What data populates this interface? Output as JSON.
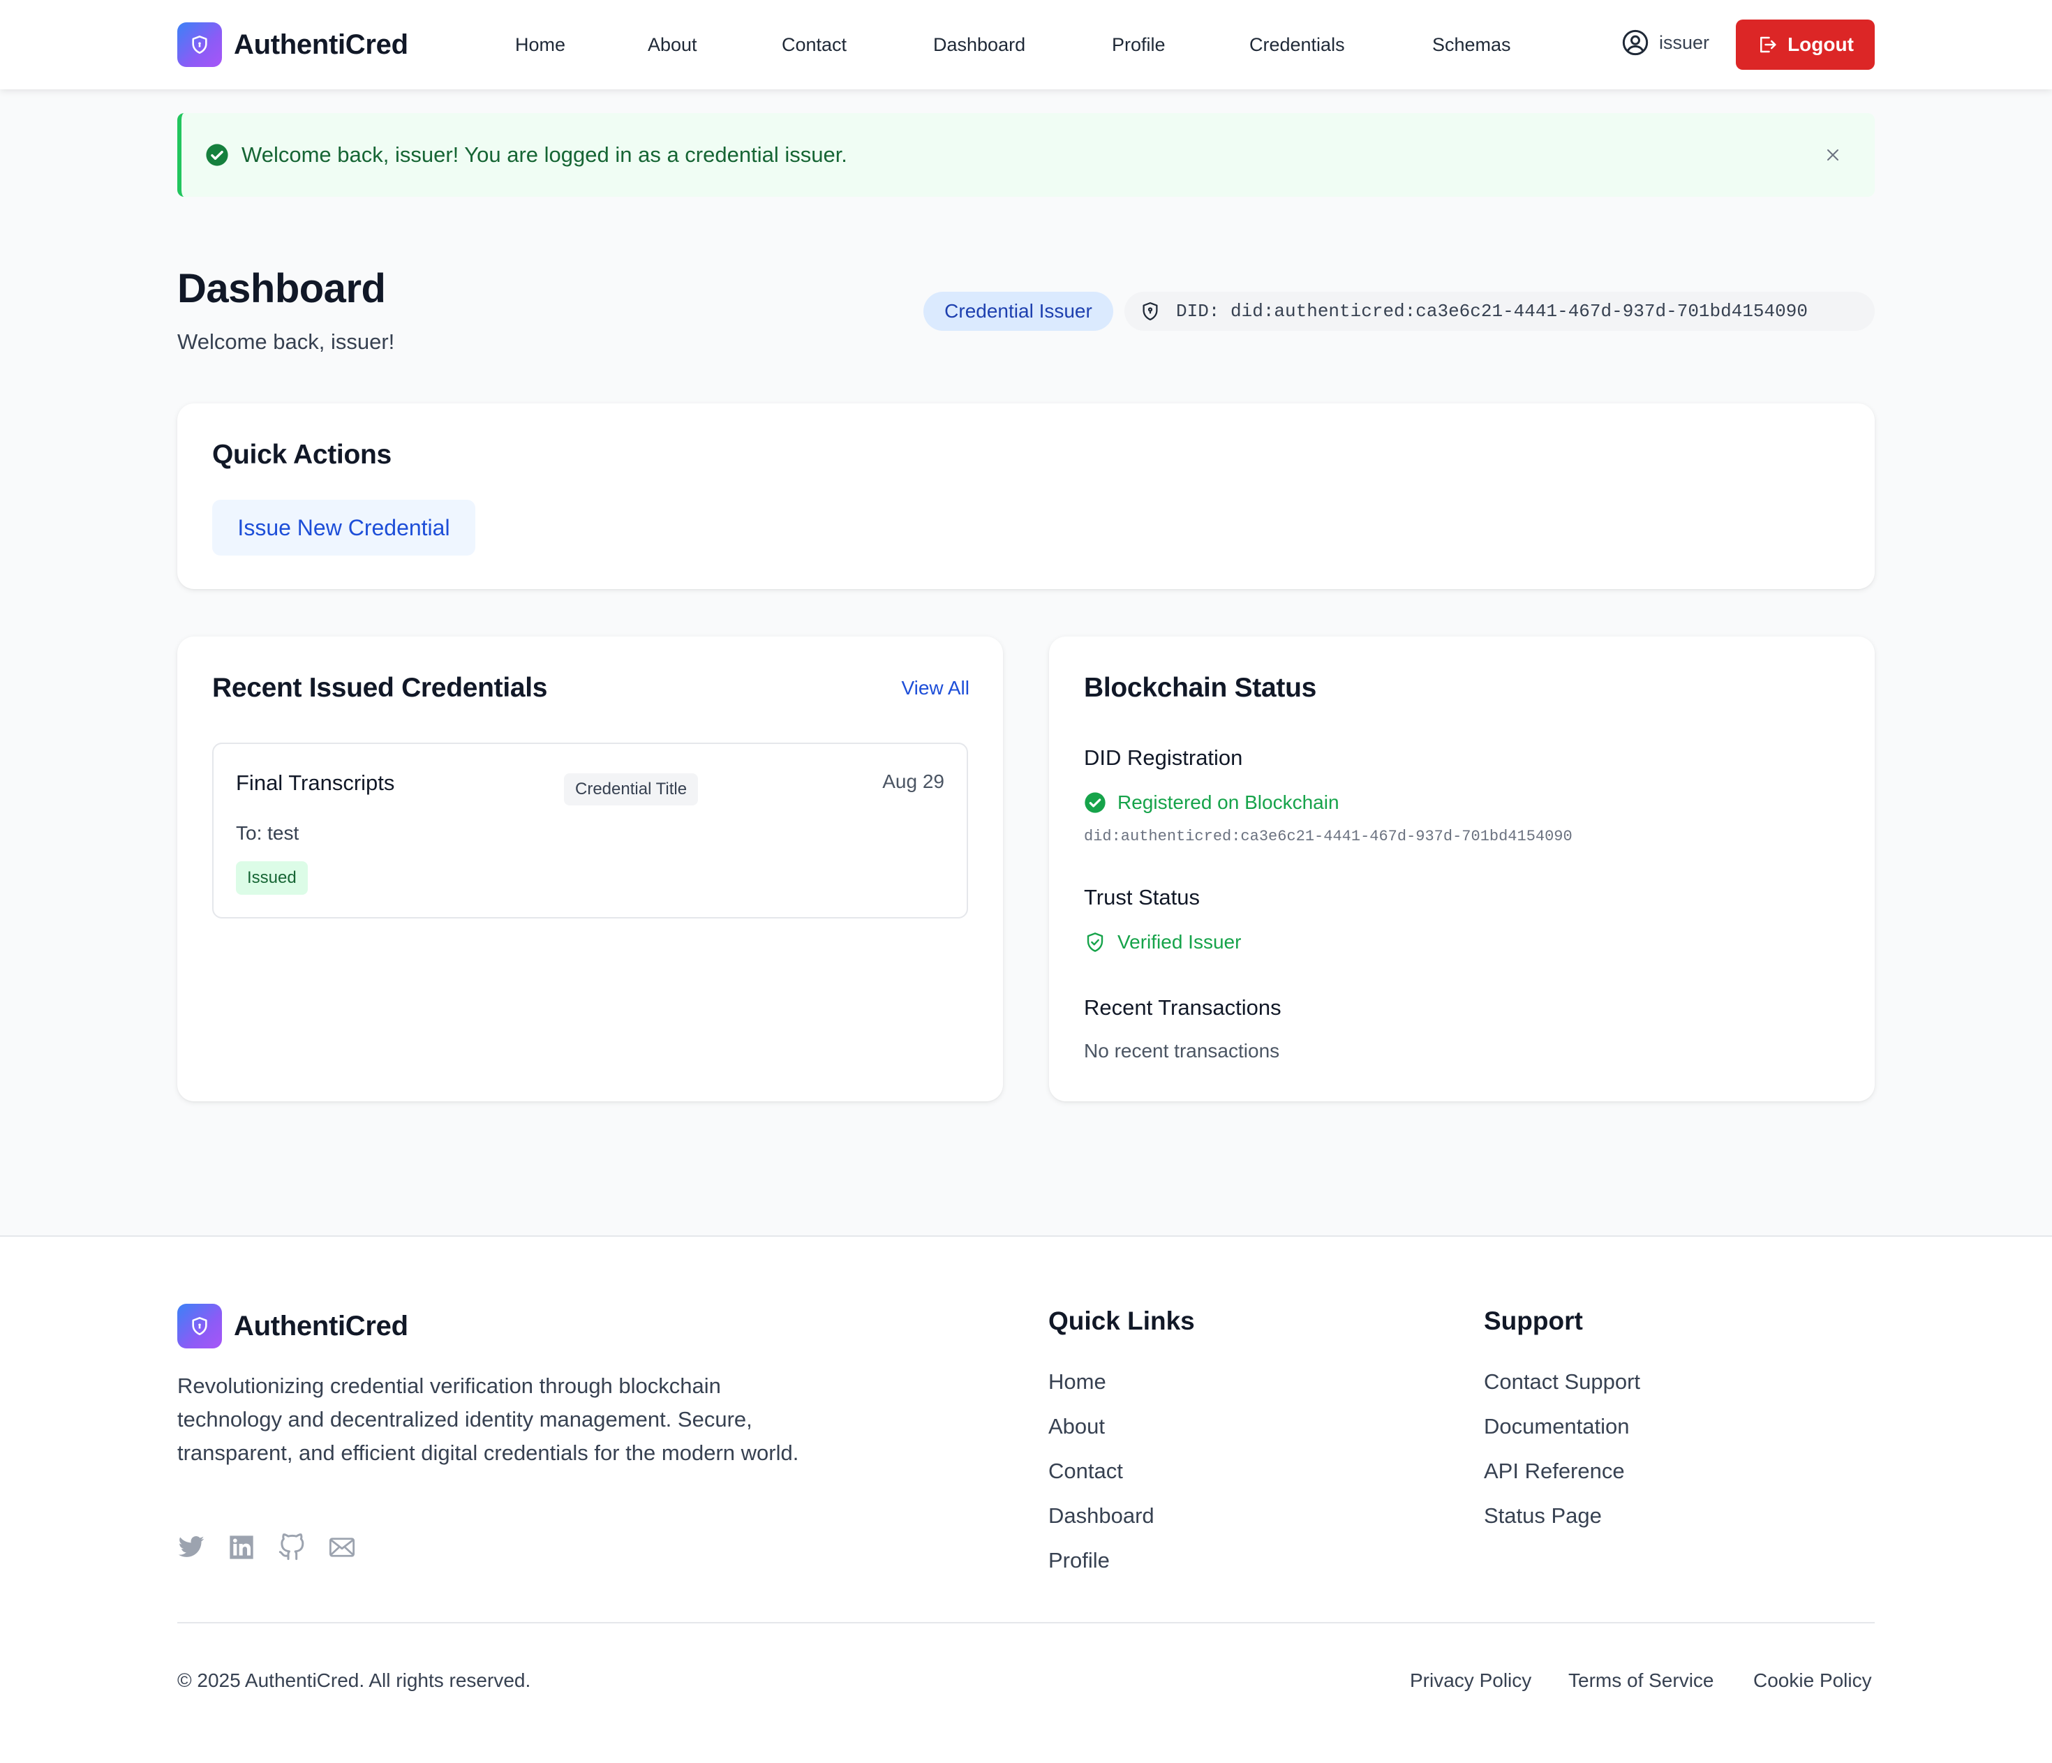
{
  "brand": {
    "name": "AuthentiCred"
  },
  "nav": {
    "links": [
      "Home",
      "About",
      "Contact",
      "Dashboard",
      "Profile",
      "Credentials",
      "Schemas"
    ],
    "user": "issuer",
    "logout_label": "Logout"
  },
  "alert": {
    "message": "Welcome back, issuer! You are logged in as a credential issuer.",
    "close_glyph": "×"
  },
  "header": {
    "title": "Dashboard",
    "subtitle": "Welcome back, issuer!",
    "role_badge": "Credential Issuer",
    "did_label": "DID: did:authenticred:ca3e6c21-4441-467d-937d-701bd4154090"
  },
  "quick_actions": {
    "title": "Quick Actions",
    "issue_button": "Issue New Credential"
  },
  "recent": {
    "title": "Recent Issued Credentials",
    "view_all": "View All",
    "items": [
      {
        "title": "Final Transcripts",
        "tag": "Credential Title",
        "date": "Aug 29",
        "recipient": "To: test",
        "status": "Issued"
      }
    ]
  },
  "blockchain": {
    "title": "Blockchain Status",
    "did_registration_label": "DID Registration",
    "did_status": "Registered on Blockchain",
    "did_value": "did:authenticred:ca3e6c21-4441-467d-937d-701bd4154090",
    "trust_label": "Trust Status",
    "trust_status": "Verified Issuer",
    "transactions_label": "Recent Transactions",
    "transactions_empty": "No recent transactions"
  },
  "footer": {
    "description": "Revolutionizing credential verification through blockchain technology and decentralized identity management. Secure, transparent, and efficient digital credentials for the modern world.",
    "social_icons": [
      "twitter-icon",
      "linkedin-icon",
      "github-icon",
      "mail-icon"
    ],
    "quick_links_title": "Quick Links",
    "quick_links": [
      "Home",
      "About",
      "Contact",
      "Dashboard",
      "Profile"
    ],
    "support_title": "Support",
    "support_links": [
      "Contact Support",
      "Documentation",
      "API Reference",
      "Status Page"
    ],
    "copyright": "© 2025 AuthentiCred. All rights reserved.",
    "legal_links": [
      "Privacy Policy",
      "Terms of Service",
      "Cookie Policy"
    ]
  },
  "colors": {
    "primary": "#1d4ed8",
    "danger": "#dc2626",
    "success": "#16a34a",
    "brand_gradient_start": "#3b82f6",
    "brand_gradient_end": "#a855f7"
  }
}
